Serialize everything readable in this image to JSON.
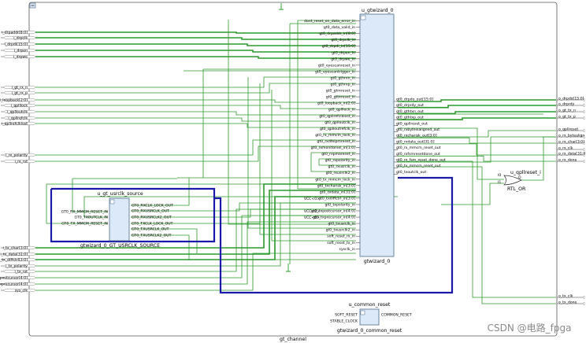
{
  "design_title": "gt_channel",
  "watermark": "CSDN @电路_fpga",
  "gtwizard": {
    "instance": "u_gtwizard_0",
    "module": "gtwizard_0",
    "left_pins": [
      "dont_reset_on_data_error_in",
      "gt0_data_valid_in",
      "gt0_drpaddr_in[8:0]",
      "gt0_drpclk_in",
      "gt0_drpdi_in[15:0]",
      "gt0_drpen_in",
      "gt0_drpwe_in",
      "gt0_eyescanreset_in",
      "gt0_eyescantrigger_in",
      "gt0_gthrxn_in",
      "gt0_gthrxp_in",
      "gt0_gtrxreset_in",
      "gt0_gttxreset_in",
      "gt0_loopback_in[2:0]",
      "gt0_qplllock_in",
      "gt0_qpllrefclklost_in",
      "gt0_qplloutclk_in",
      "gt0_qplloutrefclk_in",
      "gt0_rx_mmcm_lock_in",
      "gt0_rxdfelpmreset_in",
      "gt0_rxmonitorsel_in[1:0]",
      "gt0_rxpmareset_in",
      "gt0_rxpolarity_in",
      "gt0_rxusrclk_in",
      "gt0_rxusrclk2_in",
      "gt0_tx_mmcm_lock_in",
      "gt0_txcharisk_in[3:0]",
      "gt0_txdata_in[31:0]",
      "gt0_txdiffctrl_in[3:0]",
      "gt0_txpolarity_in",
      "gt0_txpostcursor_in[4:0]",
      "gt0_txprecursor_in[4:0]",
      "gt0_txusrclk_in",
      "gt0_txusrclk2_in",
      "soft_reset_rx_in",
      "soft_reset_tx_in",
      "sysclk_in"
    ],
    "right_pins": [
      "gt0_drpdo_out[15:0]",
      "gt0_drprdy_out",
      "gt0_gthtxn_out",
      "gt0_gthtxp_out",
      "gt0_qpllreset_out",
      "gt0_rxbyteisaligned_out",
      "gt0_rxcharisk_out[3:0]",
      "gt0_rxdata_out[31:0]",
      "gt0_rx_mmcm_reset_out",
      "gt0_rxfsmresetdone_out",
      "gt0_rx_fsm_reset_done_out",
      "gt0_tx_mmcm_reset_out",
      "gt0_txoutclk_out"
    ],
    "vcc_labels": [
      "VCC<0>",
      "VCC<0>",
      "VCC<0>"
    ]
  },
  "usrclk_source": {
    "instance": "u_gt_usrclk_source",
    "module": "gtwizard_0_GT_USRCLK_SOURCE",
    "left_pins": [
      "GT0_RX_MMCM_RESET_IN",
      "GT0_TXOUTCLK_IN",
      "GT0_TX_MMCM_RESET_IN"
    ],
    "right_pins": [
      "GT0_RXCLK_LOCK_OUT",
      "GT0_RXUSRCLK_OUT",
      "GT0_RXUSRCLK2_OUT",
      "GT0_TXCLK_LOCK_OUT",
      "GT0_TXUSRCLK_OUT",
      "GT0_TXUSRCLK2_OUT"
    ]
  },
  "common_reset": {
    "instance": "u_common_reset",
    "module": "gtwizard_0_common_reset",
    "left_pins": [
      "SOFT_RESET",
      "STABLE_CLOCK"
    ],
    "right_pins": [
      "COMMON_RESET"
    ]
  },
  "or_gate": {
    "instance": "u_qpllreset_i",
    "module": "RTL_OR",
    "pins": [
      "I0",
      "I1",
      "O"
    ]
  },
  "input_ports": [
    "i_drpaddr[8:0]",
    "i_drpclk",
    "i_drpdi[15:0]",
    "i_drpen",
    "i_drpwe",
    "i_gt_rx_n",
    "i_gt_rx_p",
    "i_loopback[2:0]",
    "i_qplllock",
    "i_qplloutclk",
    "i_qpllrefclk",
    "i_qpllrefclklost",
    "i_rx_polarity",
    "i_rx_rst",
    "i_tx_char[3:0]",
    "i_tx_data[31:0]",
    "i_tx_diffctrl[3:0]",
    "i_tx_polarity",
    "i_tx_rst",
    "i_txpostcursor[4:0]",
    "i_txprecursor[4:0]",
    "sys_clk"
  ],
  "output_ports": [
    "o_drpdo[15:0]",
    "o_drprdy",
    "o_gt_tx_n",
    "o_gt_tx_p",
    "o_qpllreset",
    "o_rx_bytealign",
    "o_rx_char[3:0]",
    "o_rx_clk",
    "o_rx_data[31:0]",
    "o_rx_done",
    "o_tx_clk",
    "o_tx_done"
  ]
}
